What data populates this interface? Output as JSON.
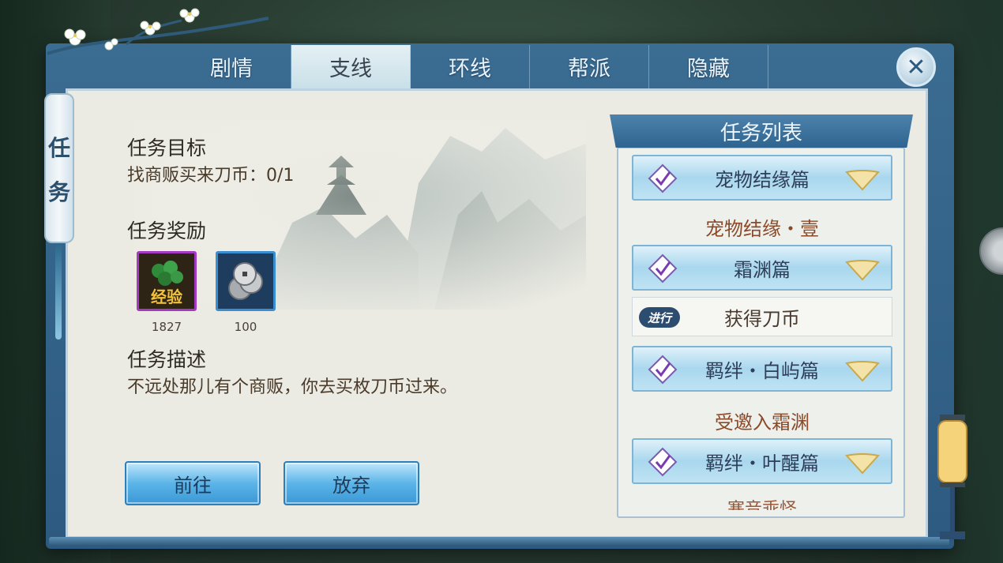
{
  "tabs": [
    "剧情",
    "支线",
    "环线",
    "帮派",
    "隐藏"
  ],
  "active_tab": 1,
  "side_label": [
    "任",
    "务"
  ],
  "objective": {
    "title": "任务目标",
    "text": "找商贩买来刀币：0/1"
  },
  "rewards": {
    "title": "任务奖励",
    "items": [
      {
        "name": "经验",
        "count": "1827",
        "icon": "exp-icon"
      },
      {
        "name": "coins",
        "count": "100",
        "icon": "coins-icon"
      }
    ]
  },
  "description": {
    "title": "任务描述",
    "text": "不远处那儿有个商贩，你去买枚刀币过来。"
  },
  "buttons": {
    "go": "前往",
    "abandon": "放弃"
  },
  "quest_list": {
    "title": "任务列表",
    "entries": [
      {
        "type": "category",
        "label": "宠物结缘篇"
      },
      {
        "type": "sub",
        "label": "宠物结缘・壹"
      },
      {
        "type": "category",
        "label": "霜渊篇"
      },
      {
        "type": "item",
        "label": "获得刀币",
        "badge": "进行"
      },
      {
        "type": "category",
        "label": "羁绊・白屿篇"
      },
      {
        "type": "sub",
        "label": "受邀入霜渊"
      },
      {
        "type": "category",
        "label": "羁绊・叶醒篇"
      },
      {
        "type": "sub",
        "label": "寒音乖怪"
      }
    ]
  },
  "colors": {
    "frame": "#2d5a80",
    "panel": "#ebebe3",
    "button": "#5cb5e8",
    "sub_quest_text": "#8a4a2a"
  }
}
